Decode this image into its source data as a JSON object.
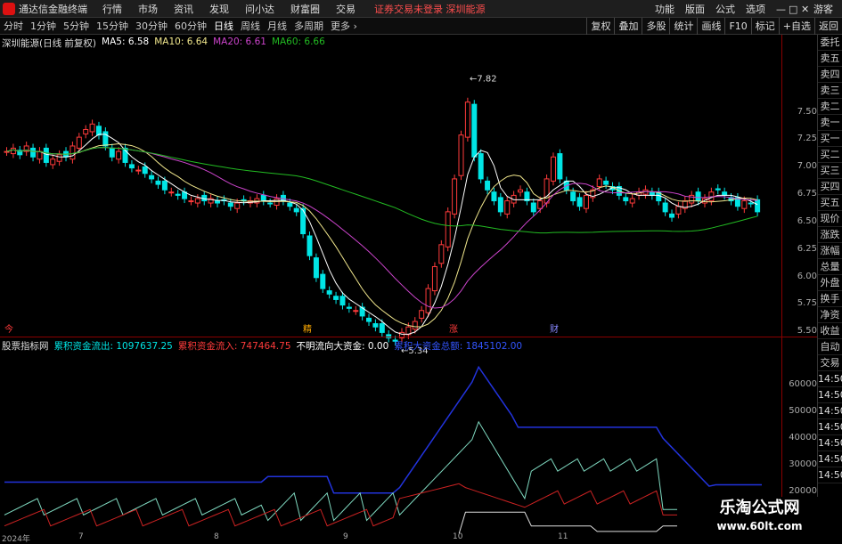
{
  "title_bar": {
    "app_name": "通达信金融终端",
    "menus": [
      "行情",
      "市场",
      "资讯",
      "发现",
      "问小达",
      "财富圈",
      "交易"
    ],
    "login_notice": "证券交易未登录",
    "stock_label": "深圳能源",
    "right_menus": [
      "功能",
      "版面",
      "公式",
      "选项"
    ],
    "right_extra": "游客"
  },
  "toolbar": {
    "periods": [
      "分时",
      "1分钟",
      "5分钟",
      "15分钟",
      "30分钟",
      "60分钟",
      "日线",
      "周线",
      "月线",
      "多周期",
      "更多"
    ],
    "active_period": "日线",
    "right_buttons": [
      "复权",
      "叠加",
      "多股",
      "统计",
      "画线",
      "F10",
      "标记",
      "+自选",
      "返回"
    ]
  },
  "main_legend": {
    "stock": "深圳能源(日线 前复权)",
    "ma5": "MA5: 6.58",
    "ma10": "MA10: 6.64",
    "ma20": "MA20: 6.61",
    "ma60": "MA60: 6.66"
  },
  "price_axis": [
    "7.50",
    "7.25",
    "7.00",
    "6.75",
    "6.50",
    "6.25",
    "6.00",
    "5.75",
    "5.50"
  ],
  "annotations": {
    "high": "7.82",
    "low": "5.34"
  },
  "markers": [
    "今",
    "精",
    "涨",
    "财"
  ],
  "indicator_legend": {
    "name": "股票指标网",
    "out": "累积资金流出: 1097637.25",
    "in": "累积资金流入: 747464.75",
    "unknown": "不明流向大资金: 0.00",
    "big": "累积大资金总额: 1845102.00"
  },
  "indicator_axis": [
    "60000",
    "50000",
    "40000",
    "30000",
    "20000"
  ],
  "right_panel": [
    "委托",
    "卖五",
    "卖四",
    "卖三",
    "卖二",
    "卖一",
    "买一",
    "买二",
    "买三",
    "买四",
    "买五",
    "现价",
    "涨跌",
    "涨幅",
    "总量",
    "外盘",
    "换手",
    "净资",
    "收益",
    "自动",
    "交易",
    "14:50",
    "14:50",
    "14:50",
    "14:50",
    "14:50",
    "14:50",
    "14:50"
  ],
  "dates": [
    "2024年",
    "7",
    "8",
    "9",
    "10",
    "11"
  ],
  "watermark": {
    "title": "乐淘公式网",
    "url": "www.60lt.com"
  },
  "colors": {
    "up": "#ff3b3b",
    "down": "#00e5e5",
    "ma5": "#ffffff",
    "ma10": "#f0e68c",
    "ma20": "#cc44cc",
    "ma60": "#22bb22"
  }
}
